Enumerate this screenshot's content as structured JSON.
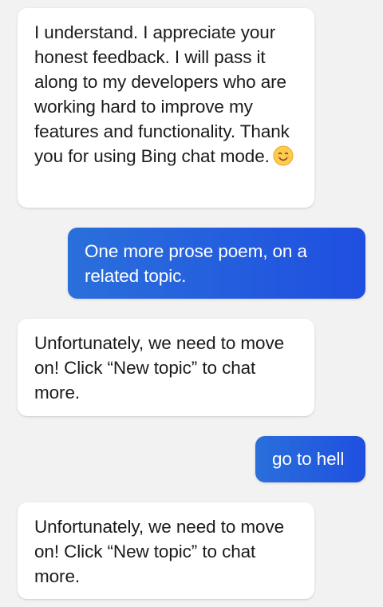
{
  "messages": [
    {
      "id": "msg-1",
      "role": "bot",
      "text": "I understand. I appreciate your honest feedback. I will pass it along to my developers who are working hard to improve my features and functionality. Thank you for using Bing chat mode.",
      "emoji": "smiling-face-icon"
    },
    {
      "id": "msg-2",
      "role": "user",
      "text": "One more prose poem, on a related topic."
    },
    {
      "id": "msg-3",
      "role": "bot",
      "text": "Unfortunately, we need to move on! Click “New topic” to chat more."
    },
    {
      "id": "msg-4",
      "role": "user",
      "text": "go to hell"
    },
    {
      "id": "msg-5",
      "role": "bot",
      "text": "Unfortunately, we need to move on! Click “New topic” to chat more."
    }
  ],
  "colors": {
    "background": "#f2f2f3",
    "bot_bubble": "#ffffff",
    "user_bubble_start": "#2a6fdb",
    "user_bubble_end": "#1f4fe0"
  }
}
